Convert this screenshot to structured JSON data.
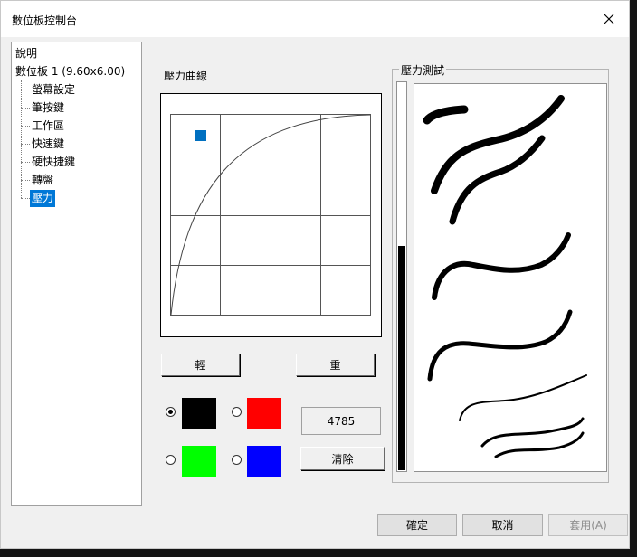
{
  "window": {
    "title": "數位板控制台"
  },
  "tree": {
    "items": [
      {
        "label": "說明",
        "selected": false
      },
      {
        "label": "數位板  1 (9.60x6.00)",
        "selected": false
      },
      {
        "label": "螢幕設定",
        "selected": false
      },
      {
        "label": "筆按鍵",
        "selected": false
      },
      {
        "label": "工作區",
        "selected": false
      },
      {
        "label": "快速鍵",
        "selected": false
      },
      {
        "label": "硬快捷鍵",
        "selected": false
      },
      {
        "label": "轉盤",
        "selected": false
      },
      {
        "label": "壓力",
        "selected": true
      }
    ]
  },
  "curve": {
    "label": "壓力曲線",
    "light_label": "輕",
    "heavy_label": "重",
    "handle_color": "#0070c0"
  },
  "colors": {
    "options": [
      {
        "hex": "#000000",
        "checked": true
      },
      {
        "hex": "#ff0000",
        "checked": false
      },
      {
        "hex": "#00ff00",
        "checked": false
      },
      {
        "hex": "#0000ff",
        "checked": false
      }
    ]
  },
  "pressure": {
    "value_text": "4785",
    "level": 0.58,
    "clear_label": "清除",
    "test_label": "壓力測試"
  },
  "footer": {
    "ok_label": "確定",
    "cancel_label": "取消",
    "apply_label": "套用(A)"
  },
  "icons": {
    "close": "close-icon"
  }
}
